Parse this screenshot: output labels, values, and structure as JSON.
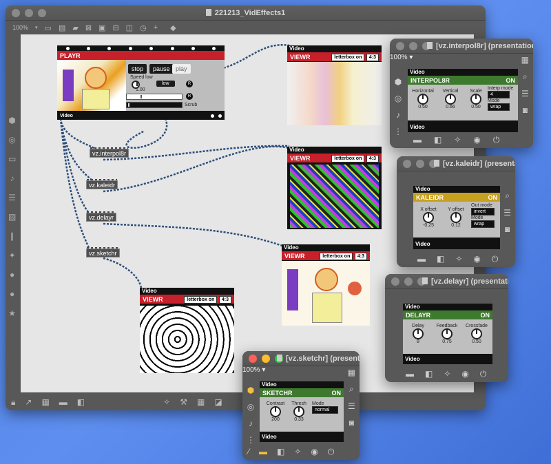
{
  "main_window": {
    "title": "221213_VidEffects1",
    "zoom": "100%",
    "toolbar_icons": [
      "grid-icon",
      "presentation-icon",
      "comment-icon",
      "clear-icon",
      "fit-icon",
      "lock-icon",
      "camera-icon",
      "time-icon",
      "plus-icon",
      "paint-icon"
    ],
    "sidebar_icons": [
      "cube-icon",
      "circle-icon",
      "device-icon",
      "note-icon",
      "list-icon",
      "image-icon",
      "clip-icon",
      "share-icon",
      "help-icon",
      "info-icon",
      "star-icon"
    ],
    "bottom_icons": [
      "lock-icon",
      "edit-icon",
      "grid-icon",
      "present-icon",
      "windows-icon",
      "sparkle-icon",
      "wrench-icon",
      "grid-2-icon",
      "layers-icon"
    ]
  },
  "playr": {
    "header": "PLAYR",
    "stop": "stop",
    "pause": "pause",
    "play": "play",
    "speed_label": "Speed low",
    "speed_value": "1.00",
    "low_btn": "low",
    "r_label": "R",
    "scrub_label": "Scrub",
    "outlet_label": "Video"
  },
  "patch_objects": [
    {
      "id": "interpol8r",
      "label": "vz.interpol8r"
    },
    {
      "id": "kaleidr",
      "label": "vz.kaleidr"
    },
    {
      "id": "delayr",
      "label": "vz.delayr"
    },
    {
      "id": "sketchr",
      "label": "vz.sketchr"
    }
  ],
  "viewrs": [
    {
      "inlet_label": "Video",
      "header": "VIEWR",
      "letterbox": "letterbox on",
      "aspect": "4:3"
    },
    {
      "inlet_label": "Video",
      "header": "VIEWR",
      "letterbox": "letterbox on",
      "aspect": "4:3"
    },
    {
      "inlet_label": "Video",
      "header": "VIEWR",
      "letterbox": "letterbox on",
      "aspect": "4:3"
    },
    {
      "inlet_label": "Video",
      "header": "VIEWR",
      "letterbox": "letterbox on",
      "aspect": "4:3"
    }
  ],
  "interpol8r_win": {
    "title": "[vz.interpol8r] (presentation)",
    "zoom": "100%",
    "inlet_label": "Video",
    "header": "INTERPOL8R",
    "status": "ON",
    "knobs": [
      {
        "label": "Horizontal",
        "value": "0.50"
      },
      {
        "label": "Vertical",
        "value": "0.66"
      },
      {
        "label": "Scale",
        "value": "0.50"
      }
    ],
    "interp_mode_label": "Interp mode",
    "interp_mode_value": "4",
    "mode_label": "Mode",
    "mode_value": "wrap",
    "outlet_label": "Video"
  },
  "kaleidr_win": {
    "title": "[vz.kaleidr] (presentation)",
    "inlet_label": "Video",
    "header": "KALEIDR",
    "status": "ON",
    "knobs": [
      {
        "label": "X offset",
        "value": "-0.25"
      },
      {
        "label": "Y offset",
        "value": "0.12"
      }
    ],
    "out_mode_label": "Out mode",
    "out_mode_value": "invert",
    "mode_label": "Mode",
    "mode_value": "wrap",
    "outlet_label": "Video"
  },
  "delayr_win": {
    "title": "[vz.delayr] (presentation)",
    "inlet_label": "Video",
    "header": "DELAYR",
    "status": "ON",
    "knobs": [
      {
        "label": "Delay",
        "value": "8"
      },
      {
        "label": "Feedback",
        "value": "0.75"
      },
      {
        "label": "Crossfade",
        "value": "0.50"
      }
    ],
    "outlet_label": "Video"
  },
  "sketchr_win": {
    "title": "[vz.sketchr] (presentation)",
    "zoom": "100%",
    "inlet_label": "Video",
    "header": "SKETCHR",
    "status": "ON",
    "knobs": [
      {
        "label": "Contrast",
        "value": "200"
      },
      {
        "label": "Thresh",
        "value": "0.33"
      }
    ],
    "mode_label": "Mode",
    "mode_value": "normal",
    "outlet_label": "Video"
  },
  "colors": {
    "red_header": "#c8202a",
    "green_header": "#3e7a2e",
    "gold_header": "#c8a020",
    "desktop": "#4f82e6"
  }
}
